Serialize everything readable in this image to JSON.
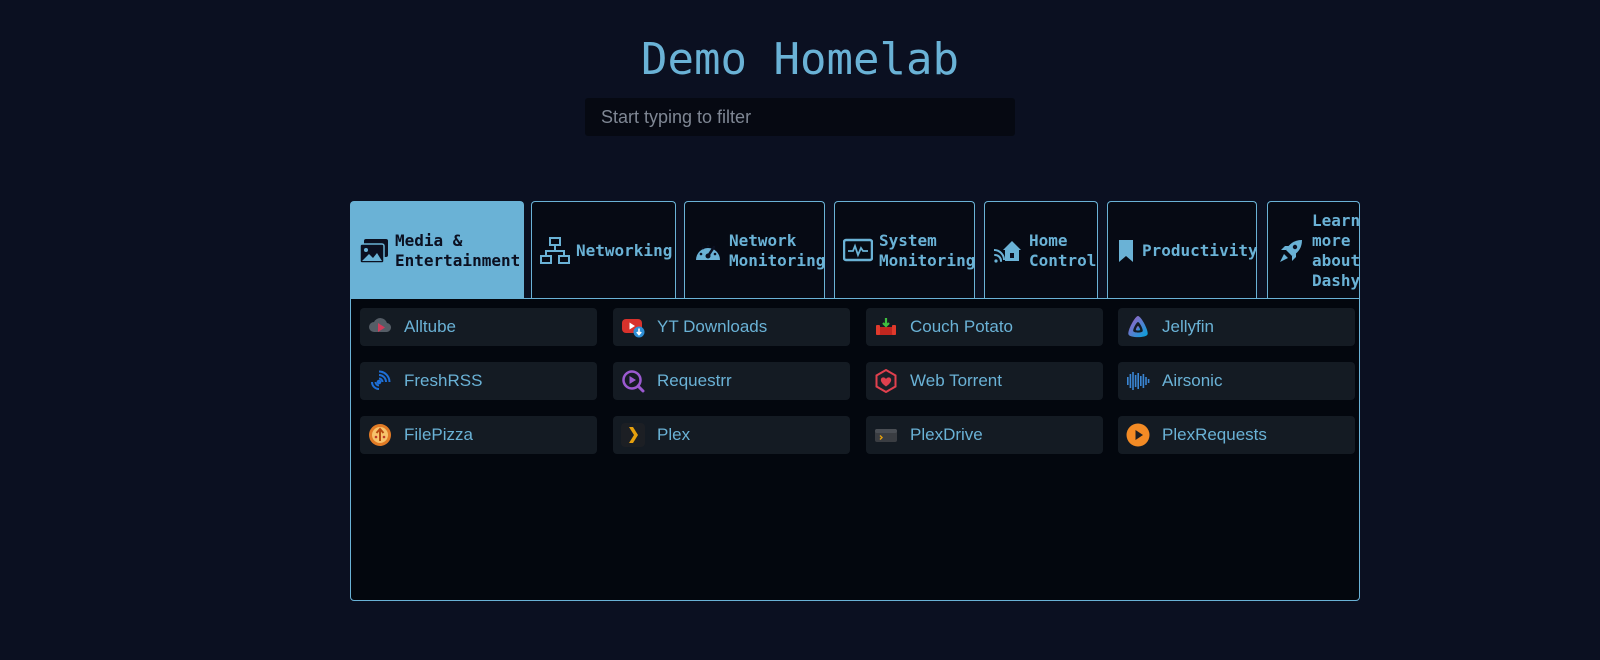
{
  "page": {
    "title": "Demo Homelab"
  },
  "search": {
    "placeholder": "Start typing to filter"
  },
  "tabs": [
    {
      "label": "Media &\nEntertainment",
      "icon": "photo-film-icon",
      "active": true
    },
    {
      "label": "Networking",
      "icon": "network-icon",
      "active": false
    },
    {
      "label": "Network\nMonitoring",
      "icon": "gauge-icon",
      "active": false
    },
    {
      "label": "System\nMonitoring",
      "icon": "monitor-waveform-icon",
      "active": false
    },
    {
      "label": "Home\nControl",
      "icon": "smart-home-icon",
      "active": false
    },
    {
      "label": "Productivity",
      "icon": "bookmark-icon",
      "active": false
    },
    {
      "label": "Learn\nmore\nabout\nDashy",
      "icon": "rocket-icon",
      "active": false
    }
  ],
  "items": [
    {
      "label": "Alltube",
      "icon": "alltube-icon"
    },
    {
      "label": "YT Downloads",
      "icon": "youtube-download-icon"
    },
    {
      "label": "Couch Potato",
      "icon": "couch-potato-icon"
    },
    {
      "label": "Jellyfin",
      "icon": "jellyfin-icon"
    },
    {
      "label": "FreshRSS",
      "icon": "freshrss-icon"
    },
    {
      "label": "Requestrr",
      "icon": "requestrr-icon"
    },
    {
      "label": "Web Torrent",
      "icon": "webtorrent-icon"
    },
    {
      "label": "Airsonic",
      "icon": "airsonic-icon"
    },
    {
      "label": "FilePizza",
      "icon": "filepizza-icon"
    },
    {
      "label": "Plex",
      "icon": "plex-icon"
    },
    {
      "label": "PlexDrive",
      "icon": "plexdrive-icon"
    },
    {
      "label": "PlexRequests",
      "icon": "plexrequests-icon"
    }
  ],
  "colors": {
    "background": "#0b1021",
    "accent": "#6ab2d6",
    "panel": "#03070e",
    "item": "#141b23"
  }
}
